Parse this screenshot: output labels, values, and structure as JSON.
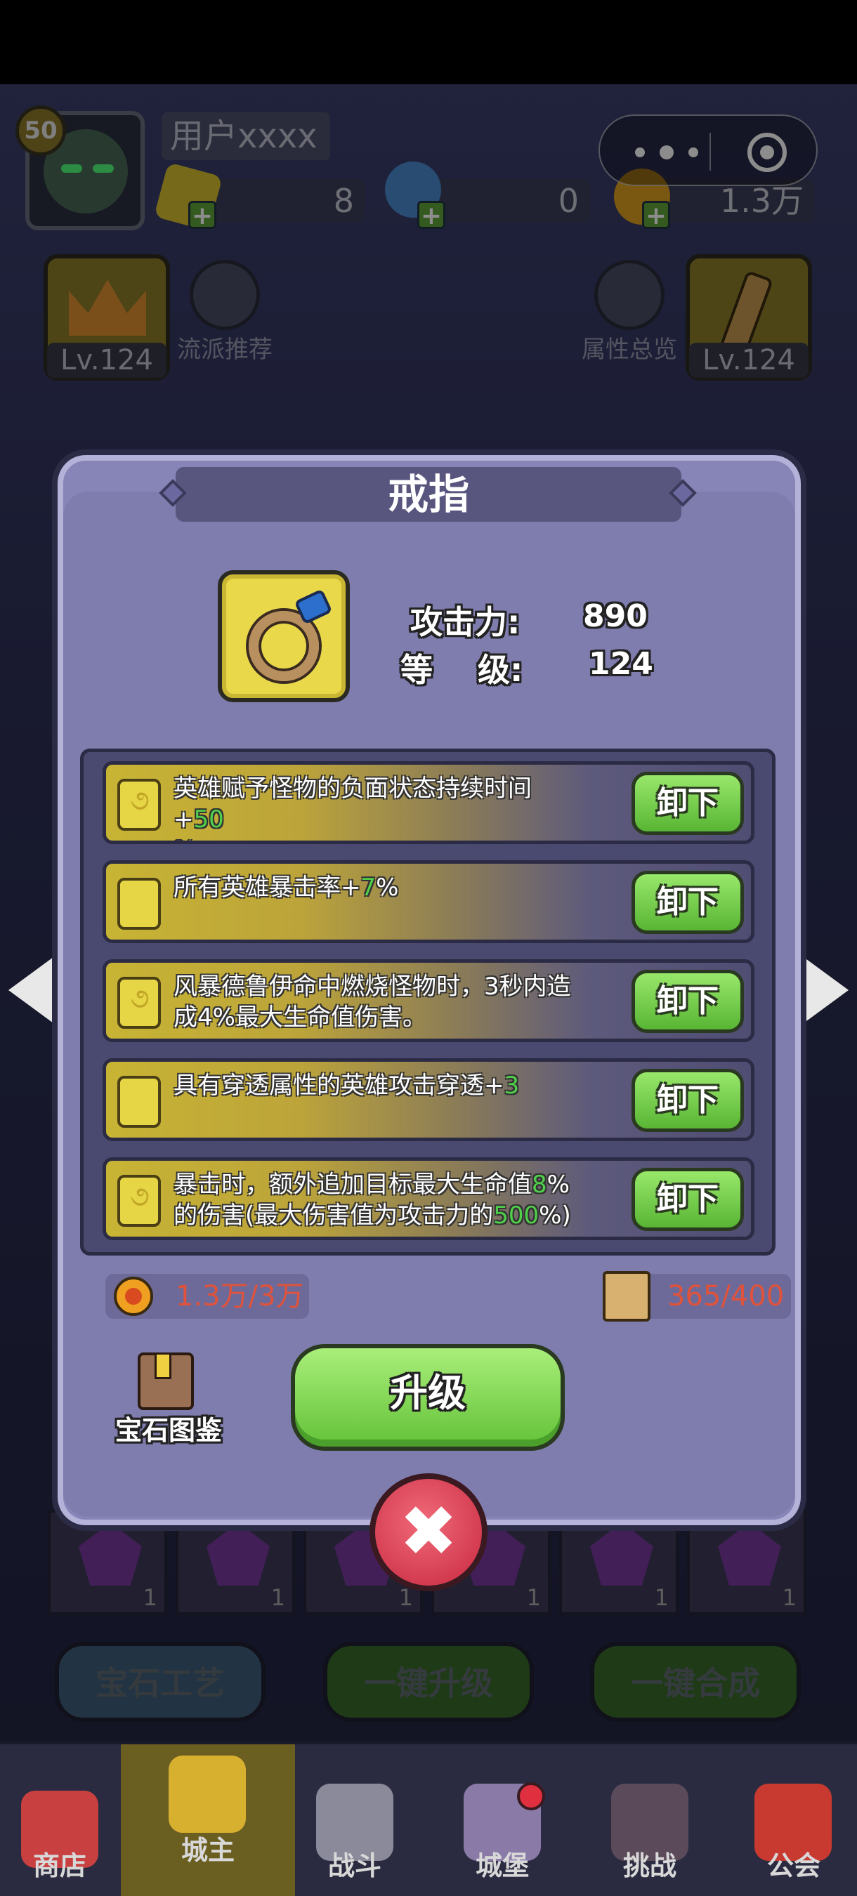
{
  "header": {
    "player_level": "50",
    "username": "用户xxxx",
    "resources": [
      {
        "icon": "gem-icon",
        "value": "8"
      },
      {
        "icon": "potion-icon",
        "value": "0"
      },
      {
        "icon": "coin-icon",
        "value": "1.3万"
      }
    ]
  },
  "side": {
    "left_slot_level": "Lv.124",
    "right_slot_level": "Lv.124",
    "left_label": "流派推荐",
    "right_label": "属性总览"
  },
  "panel": {
    "title": "戒指",
    "stats": [
      {
        "label": "攻击力:",
        "value": "890"
      },
      {
        "label": "等    级:",
        "value": "124"
      }
    ],
    "gems": [
      {
        "text_pre": "英雄赋予怪物的负面状态持续时间+",
        "highlight": "50",
        "text_post": "%",
        "button": "卸下"
      },
      {
        "text_pre": "所有英雄暴击率+",
        "highlight": "7",
        "text_post": "%",
        "button": "卸下"
      },
      {
        "text_pre": "风暴德鲁伊命中燃烧怪物时，3秒内造成4%最大生命值伤害。",
        "highlight": "",
        "text_post": "",
        "button": "卸下"
      },
      {
        "text_pre": "具有穿透属性的英雄攻击穿透+",
        "highlight": "3",
        "text_post": "",
        "button": "卸下"
      },
      {
        "text_pre": "暴击时，额外追加目标最大生命值",
        "highlight": "8",
        "text_mid": "%的伤害(最大伤害值为攻击力的",
        "highlight2": "500",
        "text_post": "%)",
        "button": "卸下"
      }
    ],
    "coin_cost": "1.3万/3万",
    "scroll_cost": "365/400",
    "book_label": "宝石图鉴",
    "upgrade_label": "升级"
  },
  "bottom_slots": [
    {
      "count": "1"
    },
    {
      "count": "1"
    },
    {
      "count": "1"
    },
    {
      "count": "1"
    },
    {
      "count": "1"
    },
    {
      "count": "1"
    }
  ],
  "actions": {
    "craft": "宝石工艺",
    "upgrade_all": "一键升级",
    "merge_all": "一键合成"
  },
  "tabs": [
    {
      "label": "商店",
      "icon": "shop-icon"
    },
    {
      "label": "城主",
      "icon": "crown-icon",
      "active": true
    },
    {
      "label": "战斗",
      "icon": "swords-icon"
    },
    {
      "label": "城堡",
      "icon": "castle-icon"
    },
    {
      "label": "挑战",
      "icon": "demon-icon"
    },
    {
      "label": "公会",
      "icon": "banner-icon"
    }
  ],
  "colors": {
    "highlight_green": "#4fcf4a",
    "cost_red": "#e0533a",
    "button_green": "#63c238",
    "panel_purple": "#8784b8"
  }
}
